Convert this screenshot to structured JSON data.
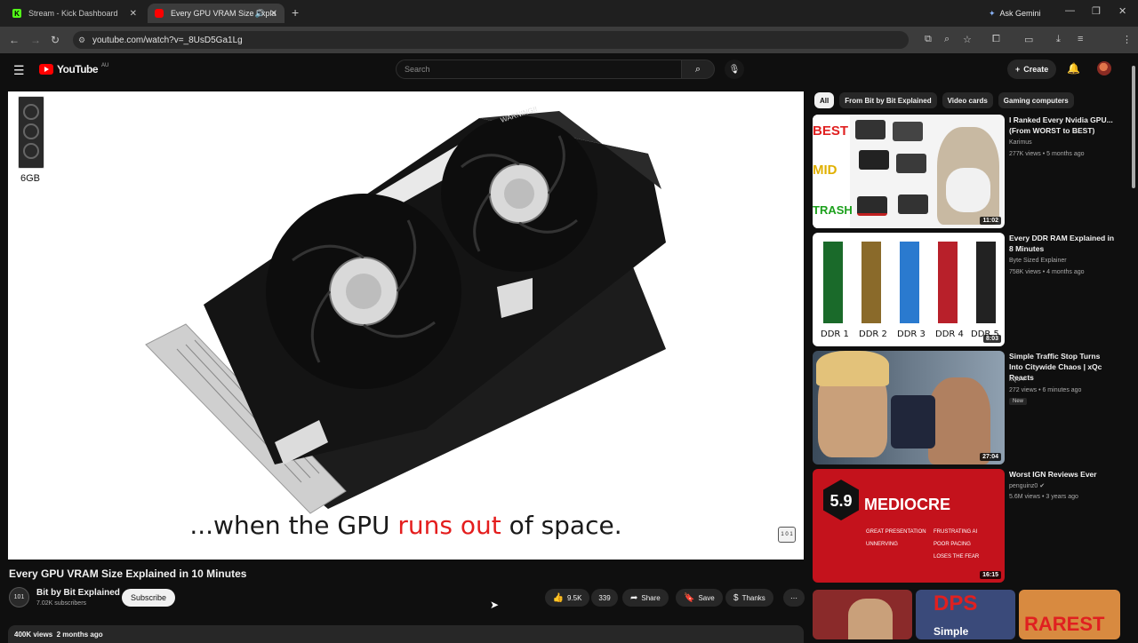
{
  "browser": {
    "tabs": [
      {
        "title": "Stream - Kick Dashboard"
      },
      {
        "title": "Every GPU VRAM Size Expla"
      }
    ],
    "new_tab": "+",
    "ask_gemini": "Ask Gemini",
    "url": "youtube.com/watch?v=_8UsD5Ga1Lg",
    "window_controls": [
      "—",
      "❐",
      "✕"
    ]
  },
  "youtube": {
    "logo_text": "YouTube",
    "country": "AU",
    "search_placeholder": "Search",
    "create_label": "Create"
  },
  "player": {
    "mini_label": "6GB",
    "caption_pre": "...when the GPU ",
    "caption_red": "runs out",
    "caption_post": " of space.",
    "watermark": "1 0 1"
  },
  "video": {
    "title": "Every GPU VRAM Size Explained in 10 Minutes",
    "channel": "Bit by Bit Explained",
    "subscribers": "7.02K subscribers",
    "subscribe_label": "Subscribe",
    "likes": "9.5K",
    "comments": "339",
    "share_label": "Share",
    "save_label": "Save",
    "thanks_label": "Thanks",
    "views": "400K views",
    "age": "2 months ago",
    "avatar_text": "101"
  },
  "filters": [
    "All",
    "From Bit by Bit Explained",
    "Video cards",
    "Gaming computers"
  ],
  "recommendations": [
    {
      "title": "I Ranked Every Nvidia GPU... (From WORST to BEST)",
      "channel": "Karimus",
      "meta": "277K views • 5 months ago",
      "duration": "11:02",
      "thumb_labels": [
        "BEST",
        "MID",
        "TRASH"
      ]
    },
    {
      "title": "Every DDR RAM Explained in 8 Minutes",
      "channel": "Byte Sized Explainer",
      "meta": "758K views • 4 months ago",
      "duration": "8:03",
      "thumb_labels": [
        "DDR 1",
        "DDR 2",
        "DDR 3",
        "DDR 4",
        "DDR 5"
      ]
    },
    {
      "title": "Simple Traffic Stop Turns Into Citywide Chaos | xQc Reacts",
      "channel": "xQc",
      "meta": "272 views • 6 minutes ago",
      "badge": "New",
      "duration": "27:04"
    },
    {
      "title": "Worst IGN Reviews Ever",
      "channel": "penguinz0",
      "meta": "5.6M views • 3 years ago",
      "duration": "16:15",
      "thumb_labels": [
        "5.9",
        "MEDIOCRE",
        "GREAT PRESENTATION",
        "UNNERVING",
        "FRUSTRATING AI",
        "POOR PACING",
        "LOSES THE FEAR"
      ]
    }
  ],
  "bottom_thumbs": [
    "DPS",
    "Simple",
    "RAREST"
  ],
  "colors": {
    "bg": "#0f0f0f",
    "accent_red": "#ff0000",
    "caption_red": "#e41d1d"
  }
}
